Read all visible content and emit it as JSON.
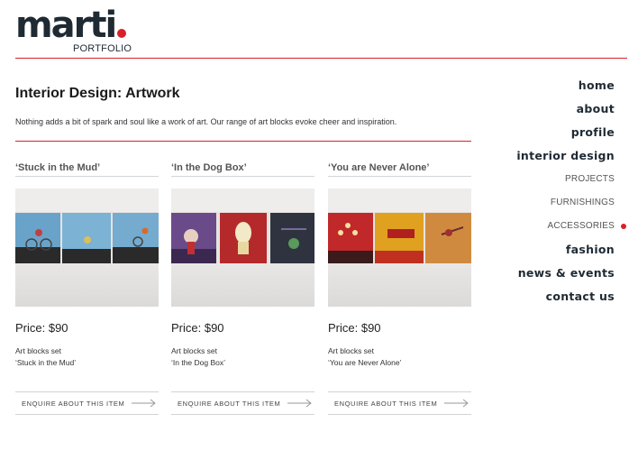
{
  "logo": {
    "word": "marti",
    "sub": "PORTFOLIO",
    "accent": "#d9202a"
  },
  "page": {
    "title": "Interior Design: Artwork",
    "intro": "Nothing adds a bit of spark and soul like a work of art. Our range of art blocks evoke cheer and inspiration."
  },
  "products": [
    {
      "name": "‘Stuck in the Mud’",
      "price": "Price: $90",
      "desc_line1": "Art blocks set",
      "desc_line2": "‘Stuck in the Mud’",
      "enquire": "ENQUIRE ABOUT THIS ITEM",
      "image_icon": "art-blocks-blue"
    },
    {
      "name": "‘In the Dog Box’",
      "price": "Price: $90",
      "desc_line1": "Art blocks set",
      "desc_line2": "‘In the Dog Box’",
      "enquire": "ENQUIRE ABOUT THIS ITEM",
      "image_icon": "art-blocks-red-purple"
    },
    {
      "name": "‘You are Never Alone’",
      "price": "Price: $90",
      "desc_line1": "Art blocks set",
      "desc_line2": "‘You are Never Alone’",
      "enquire": "ENQUIRE ABOUT THIS ITEM",
      "image_icon": "art-blocks-red-orange"
    }
  ],
  "nav": {
    "home": "home",
    "about": "about",
    "profile": "profile",
    "interior_design": "interior design",
    "projects": "PROJECTS",
    "furnishings": "FURNISHINGS",
    "accessories": "ACCESSORIES",
    "fashion": "fashion",
    "news_events": "news & events",
    "contact": "contact us",
    "active": "ACCESSORIES"
  },
  "colors": {
    "accent": "#d9202a",
    "dark": "#1f2a33"
  }
}
